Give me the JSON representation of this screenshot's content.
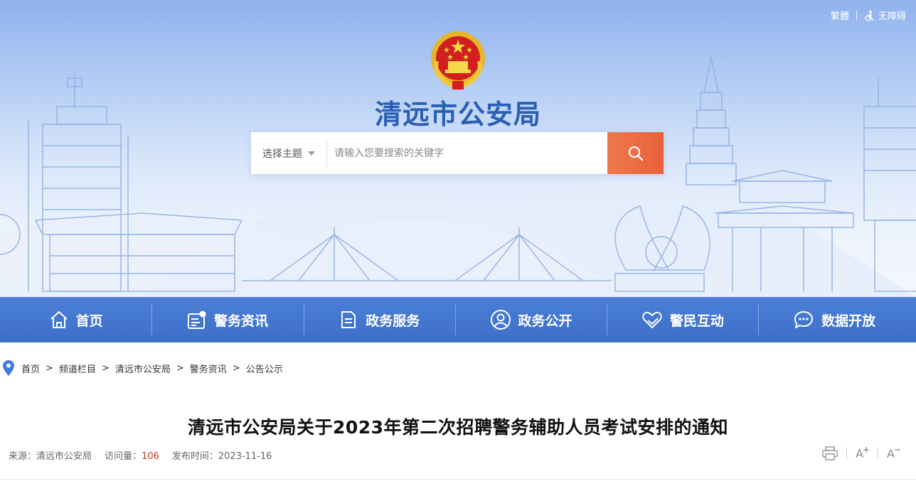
{
  "top_links": {
    "traditional_label": "繁體",
    "accessibility_label": "无障碍"
  },
  "site": {
    "title": "清远市公安局"
  },
  "search": {
    "topic_label": "选择主题",
    "placeholder": "请输入您要搜索的关键字",
    "value": ""
  },
  "nav": {
    "items": [
      {
        "label": "首页",
        "icon": "home-icon"
      },
      {
        "label": "警务资讯",
        "icon": "news-icon"
      },
      {
        "label": "政务服务",
        "icon": "document-icon"
      },
      {
        "label": "政务公开",
        "icon": "user-circle-icon"
      },
      {
        "label": "警民互动",
        "icon": "heart-hand-icon"
      },
      {
        "label": "数据开放",
        "icon": "chat-bubble-icon"
      }
    ]
  },
  "breadcrumb": {
    "items": [
      "首页",
      "频道栏目",
      "清远市公安局",
      "警务资讯",
      "公告公示"
    ],
    "separator": ">"
  },
  "article": {
    "title": "清远市公安局关于2023年第二次招聘警务辅助人员考试安排的通知",
    "source_label": "来源：",
    "source_value": "清远市公安局",
    "hits_label": "访问量：",
    "hits_value": "106",
    "date_label": "发布时间：",
    "date_value": "2023-11-16"
  },
  "tools": {
    "enlarge_label": "A",
    "shrink_label": "A"
  },
  "colors": {
    "nav_blue": "#4475cf",
    "title_blue": "#2a5fb3",
    "search_orange": "#ec6d43",
    "hits_red": "#c0392b"
  }
}
